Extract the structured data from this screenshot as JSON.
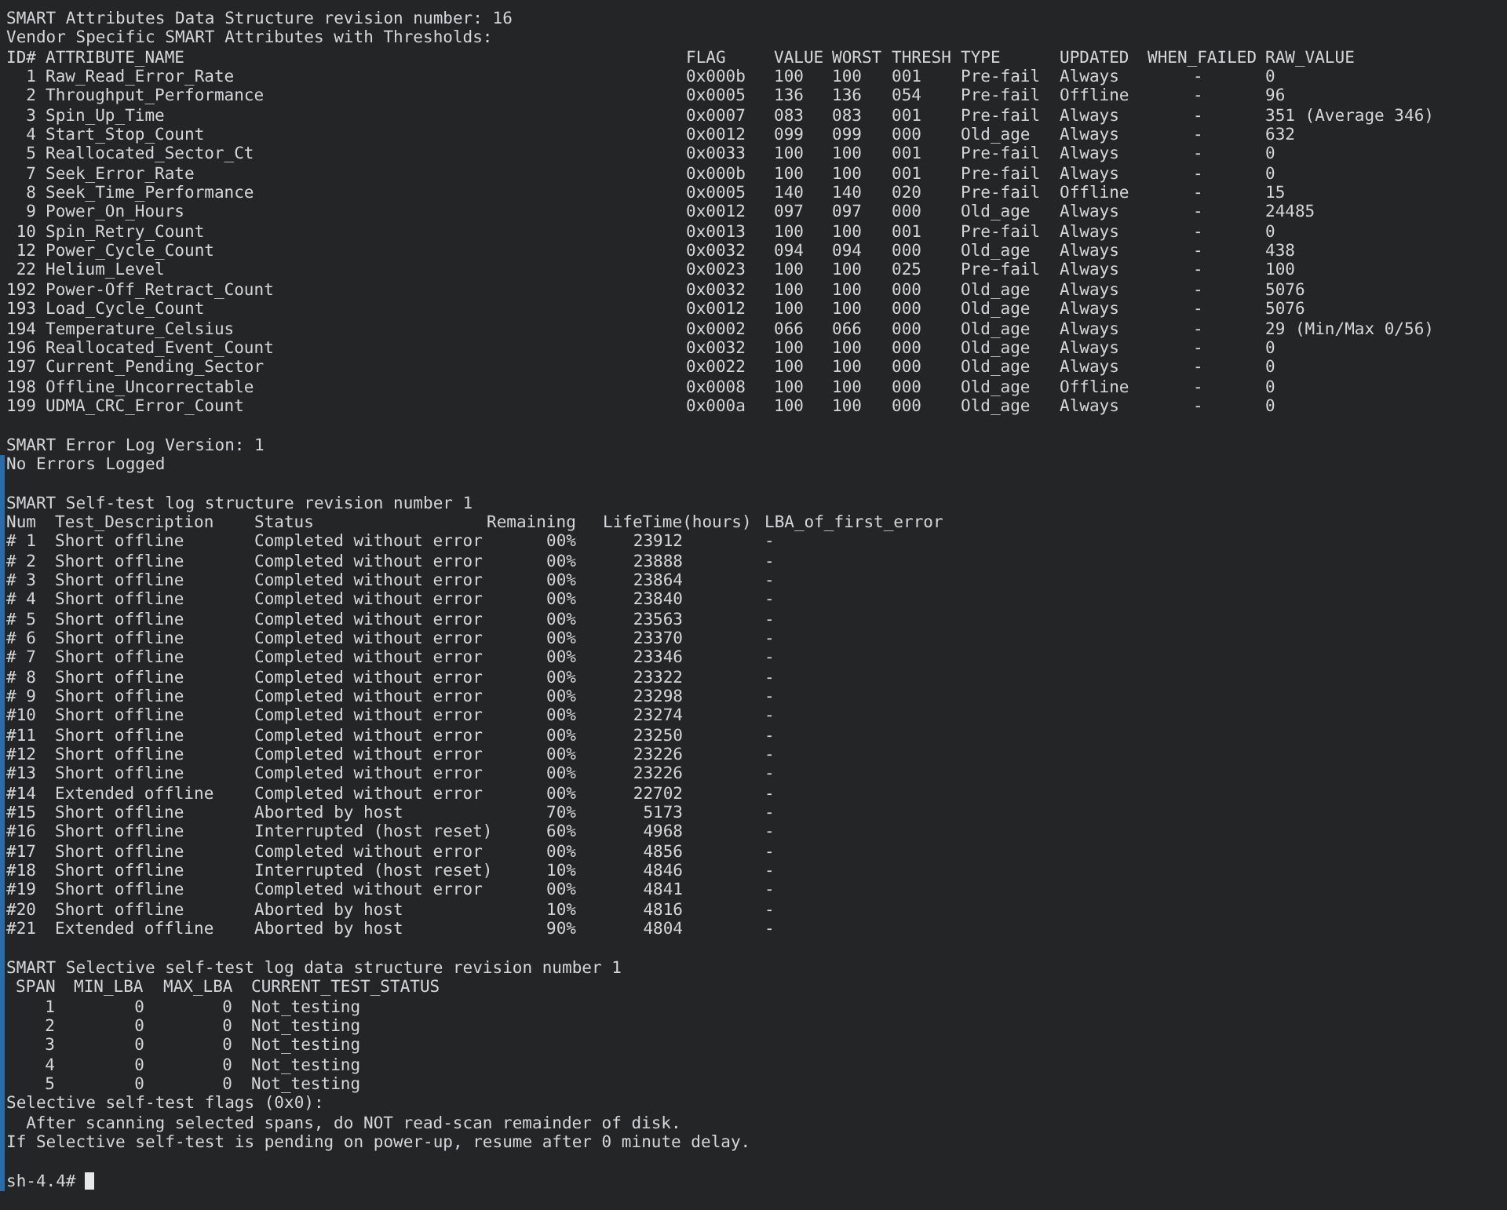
{
  "attributes": {
    "title": "SMART Attributes Data Structure revision number: 16",
    "subtitle": "Vendor Specific SMART Attributes with Thresholds:",
    "columns": [
      "ID#",
      "ATTRIBUTE_NAME",
      "FLAG",
      "VALUE",
      "WORST",
      "THRESH",
      "TYPE",
      "UPDATED",
      "WHEN_FAILED",
      "RAW_VALUE"
    ],
    "rows": [
      {
        "id": "1",
        "name": "Raw_Read_Error_Rate",
        "flag": "0x000b",
        "value": "100",
        "worst": "100",
        "thresh": "001",
        "type": "Pre-fail",
        "updated": "Always",
        "when_failed": "-",
        "raw_value": "0"
      },
      {
        "id": "2",
        "name": "Throughput_Performance",
        "flag": "0x0005",
        "value": "136",
        "worst": "136",
        "thresh": "054",
        "type": "Pre-fail",
        "updated": "Offline",
        "when_failed": "-",
        "raw_value": "96"
      },
      {
        "id": "3",
        "name": "Spin_Up_Time",
        "flag": "0x0007",
        "value": "083",
        "worst": "083",
        "thresh": "001",
        "type": "Pre-fail",
        "updated": "Always",
        "when_failed": "-",
        "raw_value": "351 (Average 346)"
      },
      {
        "id": "4",
        "name": "Start_Stop_Count",
        "flag": "0x0012",
        "value": "099",
        "worst": "099",
        "thresh": "000",
        "type": "Old_age",
        "updated": "Always",
        "when_failed": "-",
        "raw_value": "632"
      },
      {
        "id": "5",
        "name": "Reallocated_Sector_Ct",
        "flag": "0x0033",
        "value": "100",
        "worst": "100",
        "thresh": "001",
        "type": "Pre-fail",
        "updated": "Always",
        "when_failed": "-",
        "raw_value": "0"
      },
      {
        "id": "7",
        "name": "Seek_Error_Rate",
        "flag": "0x000b",
        "value": "100",
        "worst": "100",
        "thresh": "001",
        "type": "Pre-fail",
        "updated": "Always",
        "when_failed": "-",
        "raw_value": "0"
      },
      {
        "id": "8",
        "name": "Seek_Time_Performance",
        "flag": "0x0005",
        "value": "140",
        "worst": "140",
        "thresh": "020",
        "type": "Pre-fail",
        "updated": "Offline",
        "when_failed": "-",
        "raw_value": "15"
      },
      {
        "id": "9",
        "name": "Power_On_Hours",
        "flag": "0x0012",
        "value": "097",
        "worst": "097",
        "thresh": "000",
        "type": "Old_age",
        "updated": "Always",
        "when_failed": "-",
        "raw_value": "24485"
      },
      {
        "id": "10",
        "name": "Spin_Retry_Count",
        "flag": "0x0013",
        "value": "100",
        "worst": "100",
        "thresh": "001",
        "type": "Pre-fail",
        "updated": "Always",
        "when_failed": "-",
        "raw_value": "0"
      },
      {
        "id": "12",
        "name": "Power_Cycle_Count",
        "flag": "0x0032",
        "value": "094",
        "worst": "094",
        "thresh": "000",
        "type": "Old_age",
        "updated": "Always",
        "when_failed": "-",
        "raw_value": "438"
      },
      {
        "id": "22",
        "name": "Helium_Level",
        "flag": "0x0023",
        "value": "100",
        "worst": "100",
        "thresh": "025",
        "type": "Pre-fail",
        "updated": "Always",
        "when_failed": "-",
        "raw_value": "100"
      },
      {
        "id": "192",
        "name": "Power-Off_Retract_Count",
        "flag": "0x0032",
        "value": "100",
        "worst": "100",
        "thresh": "000",
        "type": "Old_age",
        "updated": "Always",
        "when_failed": "-",
        "raw_value": "5076"
      },
      {
        "id": "193",
        "name": "Load_Cycle_Count",
        "flag": "0x0012",
        "value": "100",
        "worst": "100",
        "thresh": "000",
        "type": "Old_age",
        "updated": "Always",
        "when_failed": "-",
        "raw_value": "5076"
      },
      {
        "id": "194",
        "name": "Temperature_Celsius",
        "flag": "0x0002",
        "value": "066",
        "worst": "066",
        "thresh": "000",
        "type": "Old_age",
        "updated": "Always",
        "when_failed": "-",
        "raw_value": "29 (Min/Max 0/56)"
      },
      {
        "id": "196",
        "name": "Reallocated_Event_Count",
        "flag": "0x0032",
        "value": "100",
        "worst": "100",
        "thresh": "000",
        "type": "Old_age",
        "updated": "Always",
        "when_failed": "-",
        "raw_value": "0"
      },
      {
        "id": "197",
        "name": "Current_Pending_Sector",
        "flag": "0x0022",
        "value": "100",
        "worst": "100",
        "thresh": "000",
        "type": "Old_age",
        "updated": "Always",
        "when_failed": "-",
        "raw_value": "0"
      },
      {
        "id": "198",
        "name": "Offline_Uncorrectable",
        "flag": "0x0008",
        "value": "100",
        "worst": "100",
        "thresh": "000",
        "type": "Old_age",
        "updated": "Offline",
        "when_failed": "-",
        "raw_value": "0"
      },
      {
        "id": "199",
        "name": "UDMA_CRC_Error_Count",
        "flag": "0x000a",
        "value": "100",
        "worst": "100",
        "thresh": "000",
        "type": "Old_age",
        "updated": "Always",
        "when_failed": "-",
        "raw_value": "0"
      }
    ]
  },
  "error_log": {
    "title": "SMART Error Log Version: 1",
    "message": "No Errors Logged"
  },
  "self_test_log": {
    "title": "SMART Self-test log structure revision number 1",
    "columns": [
      "Num",
      "Test_Description",
      "Status",
      "Remaining",
      "LifeTime(hours)",
      "LBA_of_first_error"
    ],
    "rows": [
      {
        "num": "# 1",
        "description": "Short offline",
        "status": "Completed without error",
        "remaining": "00%",
        "lifetime": "23912",
        "lba": "-"
      },
      {
        "num": "# 2",
        "description": "Short offline",
        "status": "Completed without error",
        "remaining": "00%",
        "lifetime": "23888",
        "lba": "-"
      },
      {
        "num": "# 3",
        "description": "Short offline",
        "status": "Completed without error",
        "remaining": "00%",
        "lifetime": "23864",
        "lba": "-"
      },
      {
        "num": "# 4",
        "description": "Short offline",
        "status": "Completed without error",
        "remaining": "00%",
        "lifetime": "23840",
        "lba": "-"
      },
      {
        "num": "# 5",
        "description": "Short offline",
        "status": "Completed without error",
        "remaining": "00%",
        "lifetime": "23563",
        "lba": "-"
      },
      {
        "num": "# 6",
        "description": "Short offline",
        "status": "Completed without error",
        "remaining": "00%",
        "lifetime": "23370",
        "lba": "-"
      },
      {
        "num": "# 7",
        "description": "Short offline",
        "status": "Completed without error",
        "remaining": "00%",
        "lifetime": "23346",
        "lba": "-"
      },
      {
        "num": "# 8",
        "description": "Short offline",
        "status": "Completed without error",
        "remaining": "00%",
        "lifetime": "23322",
        "lba": "-"
      },
      {
        "num": "# 9",
        "description": "Short offline",
        "status": "Completed without error",
        "remaining": "00%",
        "lifetime": "23298",
        "lba": "-"
      },
      {
        "num": "#10",
        "description": "Short offline",
        "status": "Completed without error",
        "remaining": "00%",
        "lifetime": "23274",
        "lba": "-"
      },
      {
        "num": "#11",
        "description": "Short offline",
        "status": "Completed without error",
        "remaining": "00%",
        "lifetime": "23250",
        "lba": "-"
      },
      {
        "num": "#12",
        "description": "Short offline",
        "status": "Completed without error",
        "remaining": "00%",
        "lifetime": "23226",
        "lba": "-"
      },
      {
        "num": "#13",
        "description": "Short offline",
        "status": "Completed without error",
        "remaining": "00%",
        "lifetime": "23226",
        "lba": "-"
      },
      {
        "num": "#14",
        "description": "Extended offline",
        "status": "Completed without error",
        "remaining": "00%",
        "lifetime": "22702",
        "lba": "-"
      },
      {
        "num": "#15",
        "description": "Short offline",
        "status": "Aborted by host",
        "remaining": "70%",
        "lifetime": "5173",
        "lba": "-"
      },
      {
        "num": "#16",
        "description": "Short offline",
        "status": "Interrupted (host reset)",
        "remaining": "60%",
        "lifetime": "4968",
        "lba": "-"
      },
      {
        "num": "#17",
        "description": "Short offline",
        "status": "Completed without error",
        "remaining": "00%",
        "lifetime": "4856",
        "lba": "-"
      },
      {
        "num": "#18",
        "description": "Short offline",
        "status": "Interrupted (host reset)",
        "remaining": "10%",
        "lifetime": "4846",
        "lba": "-"
      },
      {
        "num": "#19",
        "description": "Short offline",
        "status": "Completed without error",
        "remaining": "00%",
        "lifetime": "4841",
        "lba": "-"
      },
      {
        "num": "#20",
        "description": "Short offline",
        "status": "Aborted by host",
        "remaining": "10%",
        "lifetime": "4816",
        "lba": "-"
      },
      {
        "num": "#21",
        "description": "Extended offline",
        "status": "Aborted by host",
        "remaining": "90%",
        "lifetime": "4804",
        "lba": "-"
      }
    ]
  },
  "selective_log": {
    "title": "SMART Selective self-test log data structure revision number 1",
    "columns": [
      "SPAN",
      "MIN_LBA",
      "MAX_LBA",
      "CURRENT_TEST_STATUS"
    ],
    "rows": [
      {
        "span": "1",
        "min_lba": "0",
        "max_lba": "0",
        "status": "Not_testing"
      },
      {
        "span": "2",
        "min_lba": "0",
        "max_lba": "0",
        "status": "Not_testing"
      },
      {
        "span": "3",
        "min_lba": "0",
        "max_lba": "0",
        "status": "Not_testing"
      },
      {
        "span": "4",
        "min_lba": "0",
        "max_lba": "0",
        "status": "Not_testing"
      },
      {
        "span": "5",
        "min_lba": "0",
        "max_lba": "0",
        "status": "Not_testing"
      }
    ],
    "flags_title": "Selective self-test flags (0x0):",
    "notes": [
      "After scanning selected spans, do NOT read-scan remainder of disk.",
      "If Selective self-test is pending on power-up, resume after 0 minute delay."
    ]
  },
  "prompt": "sh-4.4#"
}
